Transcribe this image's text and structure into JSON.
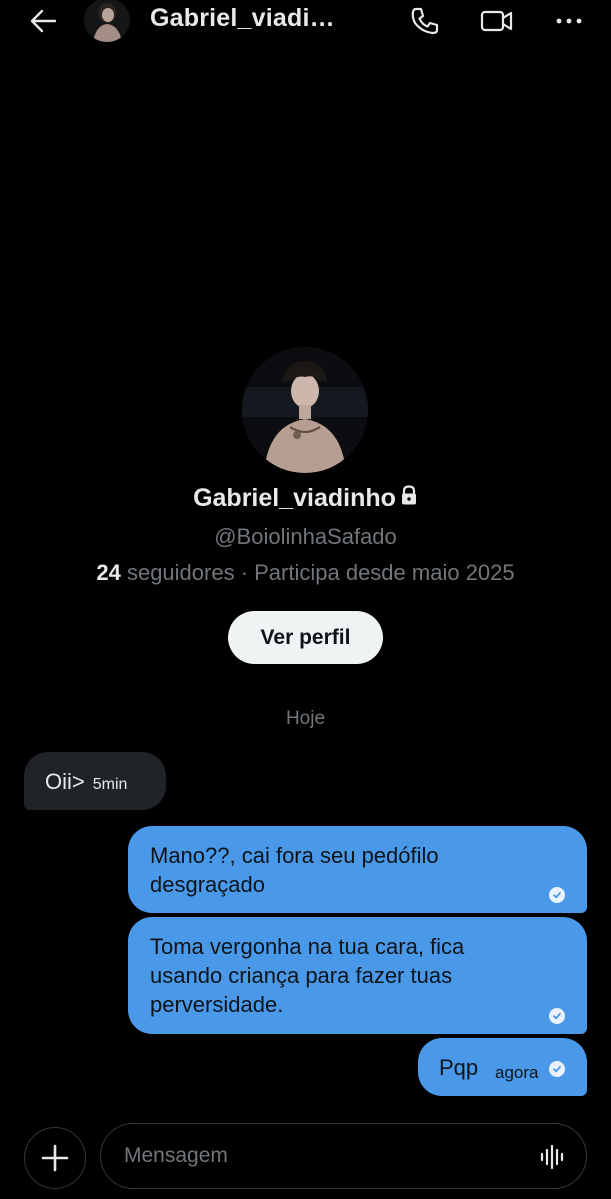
{
  "header": {
    "title": "Gabriel_viadi…",
    "icons": [
      "back-arrow-icon",
      "phone-icon",
      "video-camera-icon",
      "more-vertical-icon"
    ]
  },
  "profile": {
    "name": "Gabriel_viadinho",
    "handle": "@BoiolinhaSafado",
    "followers_count": "24",
    "followers_label": " seguidores · Participa desde maio 2025",
    "view_profile_label": "Ver perfil",
    "locked": true
  },
  "conversation": {
    "day_label": "Hoje",
    "messages": [
      {
        "direction": "in",
        "text": "Oii>",
        "time": "5min"
      },
      {
        "direction": "out",
        "text": "Mano??, cai fora seu pedófilo desgraçado",
        "read": true
      },
      {
        "direction": "out",
        "text": "Toma vergonha na tua cara, fica usando criança para fazer tuas perversidade.",
        "read": true
      },
      {
        "direction": "out",
        "text": "Pqp",
        "time": "agora",
        "read": true
      }
    ]
  },
  "composer": {
    "placeholder": "Mensagem"
  },
  "colors": {
    "background": "#000000",
    "outgoing_bubble": "#4a99e9",
    "incoming_bubble": "#202327",
    "muted_text": "#71767b",
    "primary_text": "#e7e9ea"
  }
}
